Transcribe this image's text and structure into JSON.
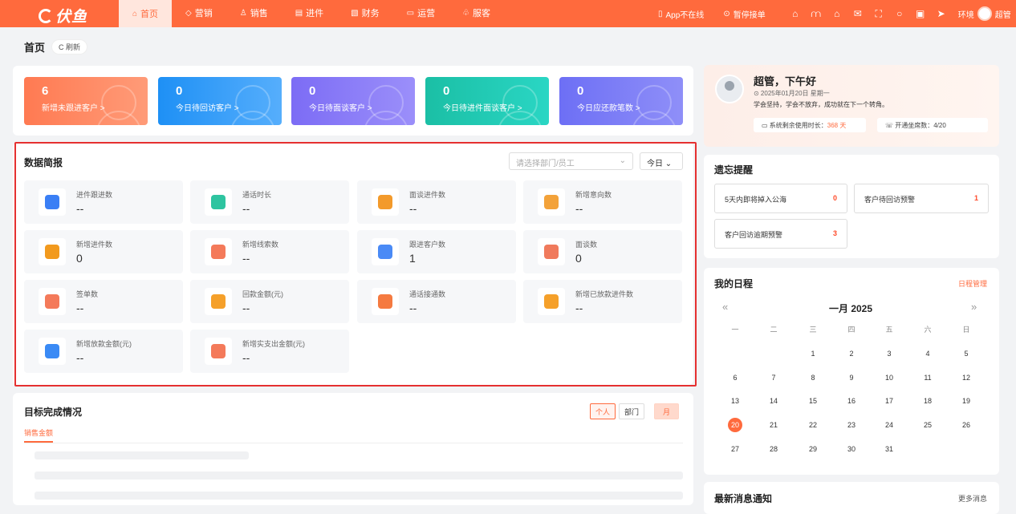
{
  "app": {
    "logo": "伏鱼"
  },
  "nav": [
    {
      "label": "首页",
      "icon": "home-icon"
    },
    {
      "label": "营销",
      "icon": "shield-icon"
    },
    {
      "label": "销售",
      "icon": "user-icon"
    },
    {
      "label": "进件",
      "icon": "document-icon"
    },
    {
      "label": "财务",
      "icon": "finance-icon"
    },
    {
      "label": "运营",
      "icon": "chat-icon"
    },
    {
      "label": "服客",
      "icon": "team-icon"
    }
  ],
  "tools": {
    "app_status": "App不在线",
    "pause": "暂停接单",
    "env": "环境",
    "user": "超管"
  },
  "breadcrumb": {
    "home": "首页",
    "refresh": "C 刷新"
  },
  "stats": [
    {
      "value": "6",
      "label": "新增未跟进客户 >"
    },
    {
      "value": "0",
      "label": "今日待回访客户 >"
    },
    {
      "value": "0",
      "label": "今日待面谈客户 >"
    },
    {
      "value": "0",
      "label": "今日待进件面谈客户 >"
    },
    {
      "value": "0",
      "label": "今日应还款笔数 >"
    }
  ],
  "report": {
    "title": "数据简报",
    "select_placeholder": "请选择部门/员工",
    "period": "今日",
    "tiles": [
      {
        "label": "进件跟进数",
        "value": "--",
        "color": "#3a7ff5"
      },
      {
        "label": "通话时长",
        "value": "--",
        "color": "#2ec4a0"
      },
      {
        "label": "面谈进件数",
        "value": "--",
        "color": "#f39a2b"
      },
      {
        "label": "新增意向数",
        "value": "--",
        "color": "#f3a23a"
      },
      {
        "label": "新增进件数",
        "value": "0",
        "color": "#f29a1e"
      },
      {
        "label": "新增线索数",
        "value": "--",
        "color": "#f47a5a"
      },
      {
        "label": "跟进客户数",
        "value": "1",
        "color": "#4a8af6"
      },
      {
        "label": "面谈数",
        "value": "0",
        "color": "#f07a5c"
      },
      {
        "label": "签单数",
        "value": "--",
        "color": "#f47a5a"
      },
      {
        "label": "回款金额(元)",
        "value": "--",
        "color": "#f5a02a"
      },
      {
        "label": "通话接通数",
        "value": "--",
        "color": "#f57a40"
      },
      {
        "label": "新增已放款进件数",
        "value": "--",
        "color": "#f5a02a"
      },
      {
        "label": "新增放款金额(元)",
        "value": "--",
        "color": "#3a8af5"
      },
      {
        "label": "新增实支出金额(元)",
        "value": "--",
        "color": "#f47a5a"
      }
    ]
  },
  "goal": {
    "title": "目标完成情况",
    "tab": "销售金额",
    "btn_personal": "个人",
    "btn_dept": "部门",
    "btn_month": "月"
  },
  "welcome": {
    "greeting": "超管，下午好",
    "date": "⊙ 2025年01月20日 星期一",
    "motto": "学会坚持，学会不放弃，成功就在下一个转角。",
    "remain_label": "系统剩余使用时长：",
    "remain_value": "368 天",
    "seats": "开通坐席数：4/20"
  },
  "memo": {
    "title": "遗忘提醒",
    "items": [
      {
        "label": "5天内即将掉入公海",
        "value": "0"
      },
      {
        "label": "客户待回访预警",
        "value": "1"
      },
      {
        "label": "客户回访逾期预警",
        "value": "3"
      }
    ]
  },
  "schedule": {
    "title": "我的日程",
    "manage": "日程管理",
    "month": "一月 2025",
    "prev": "«",
    "next": "»",
    "weekdays": [
      "一",
      "二",
      "三",
      "四",
      "五",
      "六",
      "日"
    ],
    "rows": [
      [
        "",
        "",
        "1",
        "2",
        "3",
        "4",
        "5"
      ],
      [
        "6",
        "7",
        "8",
        "9",
        "10",
        "11",
        "12"
      ],
      [
        "13",
        "14",
        "15",
        "16",
        "17",
        "18",
        "19"
      ],
      [
        "20",
        "21",
        "22",
        "23",
        "24",
        "25",
        "26"
      ],
      [
        "27",
        "28",
        "29",
        "30",
        "31",
        "",
        ""
      ]
    ],
    "today": "20"
  },
  "news": {
    "title": "最新消息通知",
    "more": "更多消息"
  }
}
